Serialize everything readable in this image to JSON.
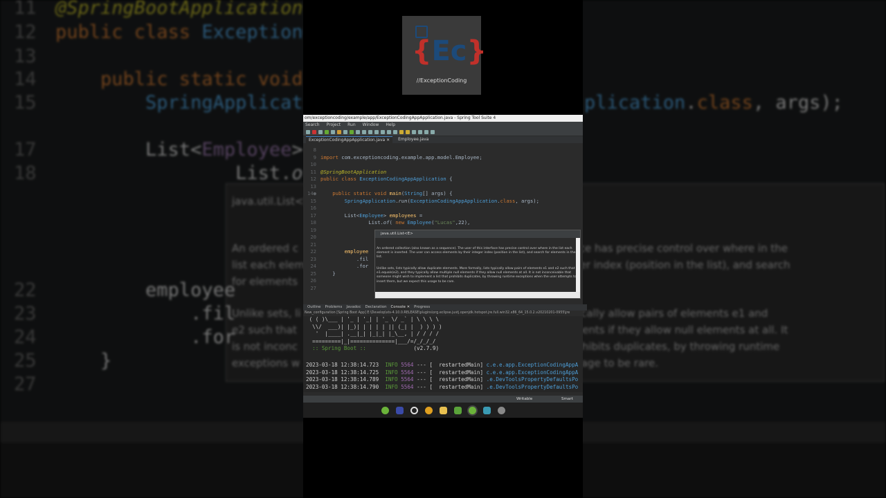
{
  "logo": {
    "mark_left": "{",
    "mark_core": "Ec",
    "mark_right": "}",
    "tagline": "//ExceptionCoding"
  },
  "window": {
    "title": "om/exceptioncoding/example/app/ExceptionCodingAppApplication.java - Spring Tool Suite 4"
  },
  "menu": [
    "Search",
    "Project",
    "Run",
    "Window",
    "Help"
  ],
  "tabs": [
    {
      "label": "ExceptionCodingAppApplication.java ✕",
      "active": true
    },
    {
      "label": "Employee.java",
      "active": false
    }
  ],
  "editor": {
    "lines": [
      {
        "n": "8",
        "t": ""
      },
      {
        "n": "9",
        "t": "import com.exceptioncoding.example.app.model.Employee;"
      },
      {
        "n": "10",
        "t": ""
      },
      {
        "n": "11",
        "t": "@SpringBootApplication"
      },
      {
        "n": "12",
        "t": "public class ExceptionCodingAppApplication {"
      },
      {
        "n": "13",
        "t": ""
      },
      {
        "n": "14●",
        "t": "    public static void main(String[] args) {"
      },
      {
        "n": "15",
        "t": "        SpringApplication.run(ExceptionCodingAppApplication.class, args);"
      },
      {
        "n": "16",
        "t": ""
      },
      {
        "n": "17",
        "t": "        List<Employee> employees ="
      },
      {
        "n": "18",
        "t": "                List.of( new Employee(\"Lucas\",22),"
      },
      {
        "n": "19",
        "t": ""
      },
      {
        "n": "20",
        "t": ""
      },
      {
        "n": "21",
        "t": ""
      },
      {
        "n": "22",
        "t": "        employee"
      },
      {
        "n": "23",
        "t": "            .fil"
      },
      {
        "n": "24",
        "t": "            .for"
      },
      {
        "n": "25",
        "t": "    }"
      },
      {
        "n": "26",
        "t": ""
      },
      {
        "n": "27",
        "t": ""
      }
    ]
  },
  "popup": {
    "header": "java.util.List<E>",
    "p1": "An ordered collection (also known as a sequence). The user of this interface has precise control over where in the list each element is inserted. The user can access elements by their integer index (position in the list), and search for elements in the list.",
    "p2": "Unlike sets, lists typically allow duplicate elements. More formally, lists typically allow pairs of elements e1 and e2 such that e1.equals(e2), and they typically allow multiple null elements if they allow null elements at all. It is not inconceivable that someone might wish to implement a list that prohibits duplicates, by throwing runtime exceptions when the user attempts to insert them, but we expect this usage to be rare."
  },
  "views": [
    "Outline",
    "Problems",
    "Javadoc",
    "Declaration",
    "Console ✕",
    "Progress"
  ],
  "console": {
    "path": "New_configuration [Spring Boot App] E:\\Develop\\sts-4.10.0.RELEASE\\plugins\\org.eclipse.justj.openjdk.hotspot.jre.full.win32.x86_64_15.0.2.v20210201-0955\\jre",
    "banner": [
      " ( ( )\\___ | '_ | '_| | '_ \\/ _` | \\ \\ \\ \\",
      "  \\\\/  ___)| |_)| | | | | || (_| |  ) ) ) )",
      "   '  |____| .__|_| |_|_| |_\\__, | / / / /",
      "  =========|_|==============|___/=/_/_/_/"
    ],
    "boot_label": "  :: Spring Boot ::",
    "boot_version": "(v2.7.9)",
    "logs": [
      {
        "ts": "2023-03-18 12:38:14.723",
        "lvl": "INFO",
        "pid": "5564",
        "thread": "--- [  restartedMain]",
        "logger": "c.e.e.app.ExceptionCodingAppA"
      },
      {
        "ts": "2023-03-18 12:38:14.725",
        "lvl": "INFO",
        "pid": "5564",
        "thread": "--- [  restartedMain]",
        "logger": "c.e.e.app.ExceptionCodingAppA"
      },
      {
        "ts": "2023-03-18 12:38:14.789",
        "lvl": "INFO",
        "pid": "5564",
        "thread": "--- [  restartedMain]",
        "logger": ".e.DevToolsPropertyDefaultsPo"
      },
      {
        "ts": "2023-03-18 12:38:14.790",
        "lvl": "INFO",
        "pid": "5564",
        "thread": "--- [  restartedMain]",
        "logger": ".e.DevToolsPropertyDefaultsPo"
      }
    ]
  },
  "status": {
    "writable": "Writable",
    "insert": "Smart Insert"
  },
  "colors": {
    "editor_bg": "#2b2b2b",
    "keyword": "#cc7832",
    "annotation": "#bbb529",
    "class": "#4e9fd9",
    "info": "#5b9b3a"
  }
}
